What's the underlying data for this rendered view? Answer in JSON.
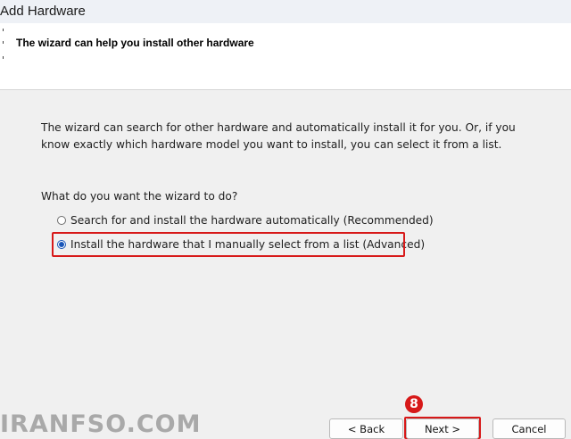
{
  "window": {
    "title": "Add Hardware"
  },
  "header": {
    "title": "The wizard can help you install other hardware"
  },
  "content": {
    "intro": "The wizard can search for other hardware and automatically install it for you. Or, if you know exactly which hardware model you want to install, you can select it from a list.",
    "question": "What do you want the wizard to do?",
    "options": [
      {
        "label": "Search for and install the hardware automatically (Recommended)",
        "selected": false
      },
      {
        "label": "Install the hardware that I manually select from a list (Advanced)",
        "selected": true
      }
    ]
  },
  "annotation": {
    "step_number": "8",
    "highlight_color": "#d71919"
  },
  "watermark": {
    "text": "IRANFSO.COM"
  },
  "buttons": {
    "back_label": "< Back",
    "next_label": "Next >",
    "cancel_label": "Cancel"
  },
  "colors": {
    "radio_accent": "#1a56b8",
    "dialog_bg": "#f0f0f0",
    "header_bg": "#ffffff"
  }
}
